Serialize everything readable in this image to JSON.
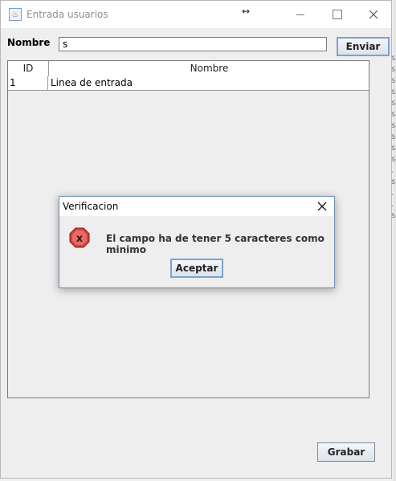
{
  "window": {
    "title": "Entrada usuarios",
    "controls": {
      "minimize": "—",
      "maximize": "☐",
      "close": "✕"
    },
    "resize_cursor": "↔"
  },
  "form": {
    "nombre_label": "Nombre",
    "nombre_value": "s",
    "enviar_label": "Enviar"
  },
  "table": {
    "columns": [
      "ID",
      "Nombre"
    ],
    "rows": [
      {
        "id": "1",
        "nombre": "Linea de entrada"
      }
    ]
  },
  "dialog": {
    "title": "Verificacion",
    "icon": "error-icon",
    "message": "El campo ha de tener 5 caracteres como minimo",
    "ok_label": "Aceptar"
  },
  "footer": {
    "grabar_label": "Grabar"
  },
  "colors": {
    "window_bg": "#eeeeee",
    "focus_border": "#7da2ce",
    "error_red": "#d9403a"
  }
}
